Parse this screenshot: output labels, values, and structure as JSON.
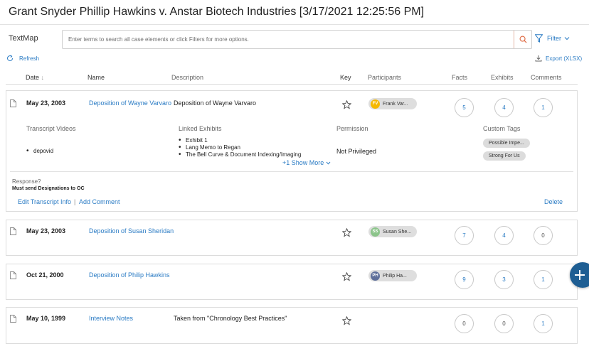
{
  "page": {
    "title": "Grant Snyder Phillip Hawkins v. Anstar Biotech Industries [3/17/2021 12:25:56 PM]"
  },
  "toolbar": {
    "textmap_label": "TextMap",
    "search_placeholder": "Enter terms to search all case elements or click Filters for more options.",
    "filter_label": "Filter",
    "refresh_label": "Refresh",
    "export_label": "Export (XLSX)"
  },
  "columns": {
    "date": "Date",
    "date_sort": "↓",
    "name": "Name",
    "description": "Description",
    "key": "Key",
    "participants": "Participants",
    "facts": "Facts",
    "exhibits": "Exhibits",
    "comments": "Comments"
  },
  "rows": [
    {
      "date": "May 23, 2003",
      "name": "Deposition of Wayne Varvaro",
      "description": "Deposition of Wayne Varvaro",
      "participant_initials": "FV",
      "participant_name": "Frank Var...",
      "participant_color": "#f5b800",
      "facts": "5",
      "exhibits": "4",
      "comments": "1",
      "details": {
        "transcript_videos_label": "Transcript Videos",
        "transcript_videos": [
          "depovid"
        ],
        "linked_exhibits_label": "Linked Exhibits",
        "linked_exhibits": [
          "Exhibit 1",
          "Lang Memo to Regan",
          "The Bell Curve & Document Indexing/Imaging"
        ],
        "show_more": "+1 Show More",
        "permission_label": "Permission",
        "permission": "Not Privileged",
        "custom_tags_label": "Custom Tags",
        "custom_tags": [
          "Possible Impe...",
          "Strong For Us"
        ],
        "response_label": "Response?",
        "response_value": "Must send Designations to OC",
        "edit_link": "Edit Transcript Info",
        "separator": "|",
        "add_comment_link": "Add Comment",
        "delete_link": "Delete"
      }
    },
    {
      "date": "May 23, 2003",
      "name": "Deposition of Susan Sheridan",
      "description": "",
      "participant_initials": "SS",
      "participant_name": "Susan She...",
      "participant_color": "#8bc48a",
      "facts": "7",
      "exhibits": "4",
      "comments": "0"
    },
    {
      "date": "Oct 21, 2000",
      "name": "Deposition of Philip Hawkins",
      "description": "",
      "participant_initials": "PH",
      "participant_name": "Philip Ha...",
      "participant_color": "#5e6f9a",
      "facts": "9",
      "exhibits": "3",
      "comments": "1"
    },
    {
      "date": "May 10, 1999",
      "name": "Interview Notes",
      "description": "Taken from \"Chronology Best Practices\"",
      "facts": "0",
      "exhibits": "0",
      "comments": "1"
    }
  ],
  "colors": {
    "accent": "#2a7bc4",
    "fab": "#1e5e93",
    "search_icon": "#e0704a"
  },
  "icons": {
    "search": "search-icon",
    "filter": "filter-icon",
    "refresh": "refresh-icon",
    "export": "download-icon",
    "doc": "document-icon",
    "star": "star-icon",
    "fab": "plus-icon"
  }
}
